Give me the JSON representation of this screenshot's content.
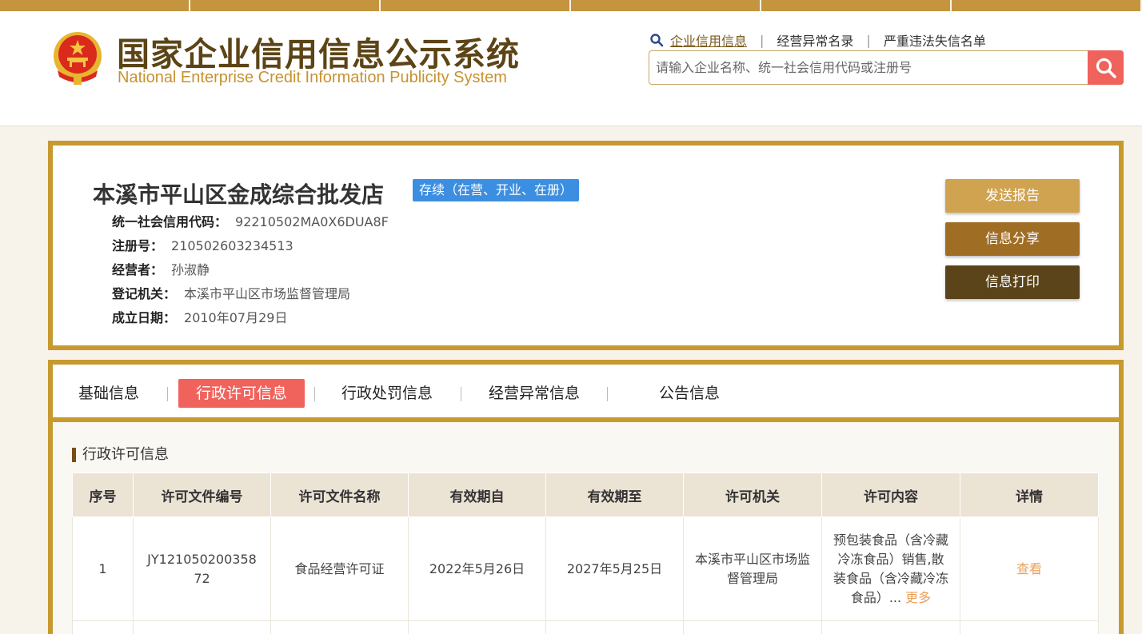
{
  "header": {
    "title_cn": "国家企业信用信息公示系统",
    "title_en": "National Enterprise Credit Information Publicity System",
    "nav_links": [
      "企业信用信息",
      "经营异常名录",
      "严重违法失信名单"
    ],
    "search_placeholder": "请输入企业名称、统一社会信用代码或注册号"
  },
  "company": {
    "name": "本溪市平山区金成综合批发店",
    "status": "存续（在营、开业、在册）",
    "fields": [
      {
        "label": "统一社会信用代码：",
        "value": "92210502MA0X6DUA8F"
      },
      {
        "label": "注册号：",
        "value": "210502603234513"
      },
      {
        "label": "经营者：",
        "value": "孙淑静"
      },
      {
        "label": "登记机关：",
        "value": "本溪市平山区市场监督管理局"
      },
      {
        "label": "成立日期：",
        "value": "2010年07月29日"
      }
    ],
    "actions": [
      "发送报告",
      "信息分享",
      "信息打印"
    ]
  },
  "tabs": [
    "基础信息",
    "行政许可信息",
    "行政处罚信息",
    "经营异常信息",
    "公告信息"
  ],
  "active_tab": "行政许可信息",
  "section_title": "行政许可信息",
  "table": {
    "columns": [
      "序号",
      "许可文件编号",
      "许可文件名称",
      "有效期自",
      "有效期至",
      "许可机关",
      "许可内容",
      "详情"
    ],
    "rows": [
      {
        "index": "1",
        "doc_no": "JY12105020035872",
        "doc_name": "食品经营许可证",
        "valid_from": "2022年5月26日",
        "valid_to": "2027年5月25日",
        "authority": "本溪市平山区市场监督管理局",
        "content": "预包装食品（含冷藏冷冻食品）销售,散装食品（含冷藏冷冻食品）...",
        "more": "更多",
        "detail": "查看"
      }
    ]
  },
  "colors": {
    "brand_gold": "#c7992f",
    "title_brown": "#5c4416",
    "accent_red": "#f0625c",
    "status_blue": "#3c8ee0"
  },
  "icons": [
    "national-emblem-icon",
    "search-icon"
  ]
}
